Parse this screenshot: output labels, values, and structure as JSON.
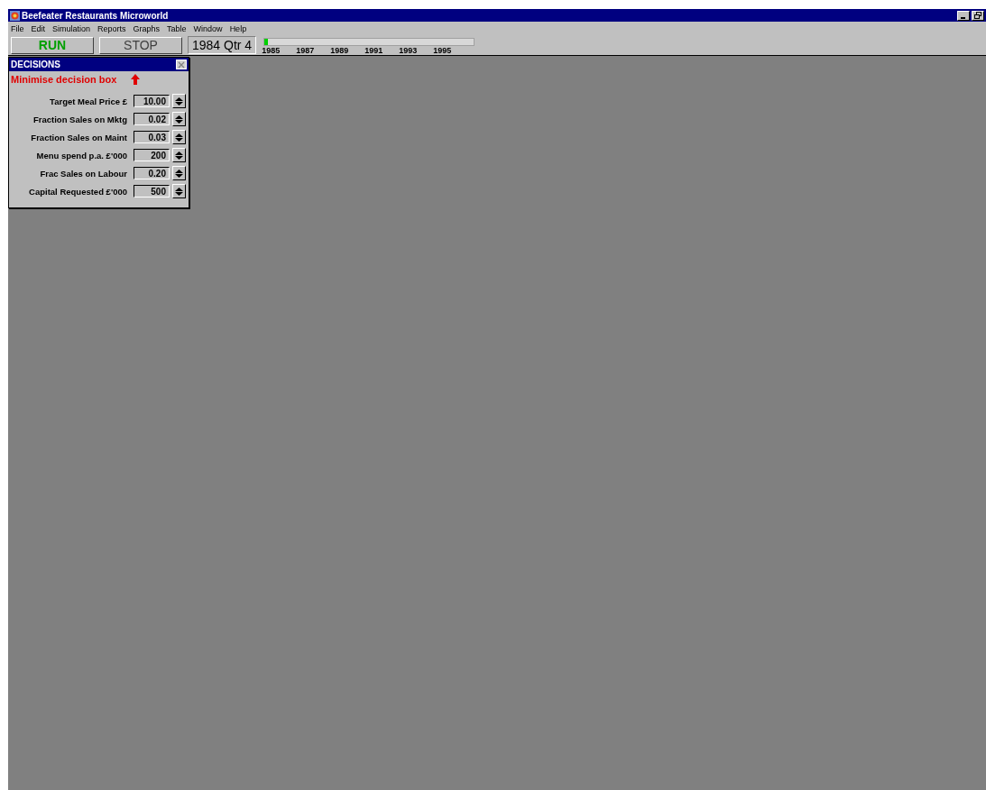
{
  "window": {
    "title": "Beefeater Restaurants Microworld"
  },
  "menu": [
    "File",
    "Edit",
    "Simulation",
    "Reports",
    "Graphs",
    "Table",
    "Window",
    "Help"
  ],
  "toolbar": {
    "run": "RUN",
    "stop": "STOP",
    "period": "1984 Qtr 4",
    "timeline": {
      "level": 0.015,
      "years": [
        "1985",
        "1987",
        "1989",
        "1991",
        "1993",
        "1995"
      ]
    }
  },
  "decisions": {
    "title": "DECISIONS",
    "minimise": "Minimise decision box",
    "fields": [
      {
        "label": "Target Meal Price  £",
        "value": "10.00"
      },
      {
        "label": "Fraction Sales on Mktg",
        "value": "0.02"
      },
      {
        "label": "Fraction Sales on Maint",
        "value": "0.03"
      },
      {
        "label": "Menu spend p.a. £'000",
        "value": "200"
      },
      {
        "label": "Frac Sales on Labour",
        "value": "0.20"
      },
      {
        "label": "Capital Requested £'000",
        "value": "500"
      }
    ]
  }
}
